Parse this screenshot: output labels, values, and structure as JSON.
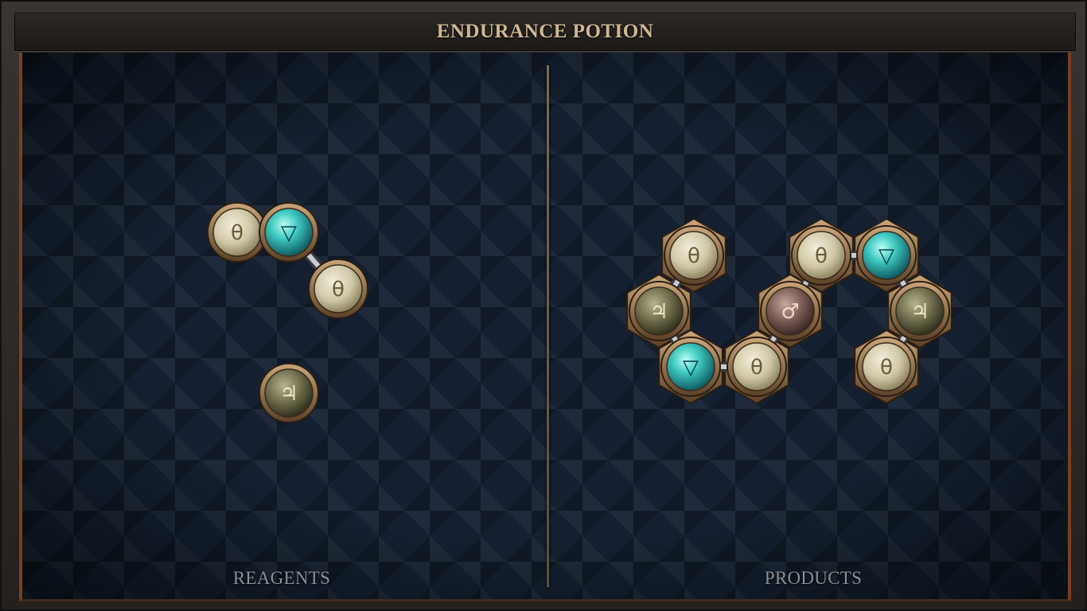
{
  "title": "ENDURANCE POTION",
  "panels": {
    "reagents_label": "REAGENTS",
    "products_label": "PRODUCTS"
  },
  "colors": {
    "salt": "#d8d2b8",
    "water": "#39b9b4",
    "earth": "#6c6a4a",
    "fire": "#7a5a52",
    "brass": "#a88a62",
    "board": "#142030"
  },
  "glyphs": {
    "salt": "θ",
    "water": "▽",
    "earth": "♃",
    "iron": "♂"
  },
  "reagents": {
    "molecules": [
      {
        "atoms": [
          "salt",
          "water",
          "salt"
        ]
      },
      {
        "atoms": [
          "earth"
        ]
      }
    ]
  },
  "products": {
    "molecules": [
      {
        "atoms": [
          "salt",
          "earth",
          "water",
          "salt",
          "iron",
          "salt",
          "water",
          "earth",
          "salt"
        ]
      }
    ]
  }
}
